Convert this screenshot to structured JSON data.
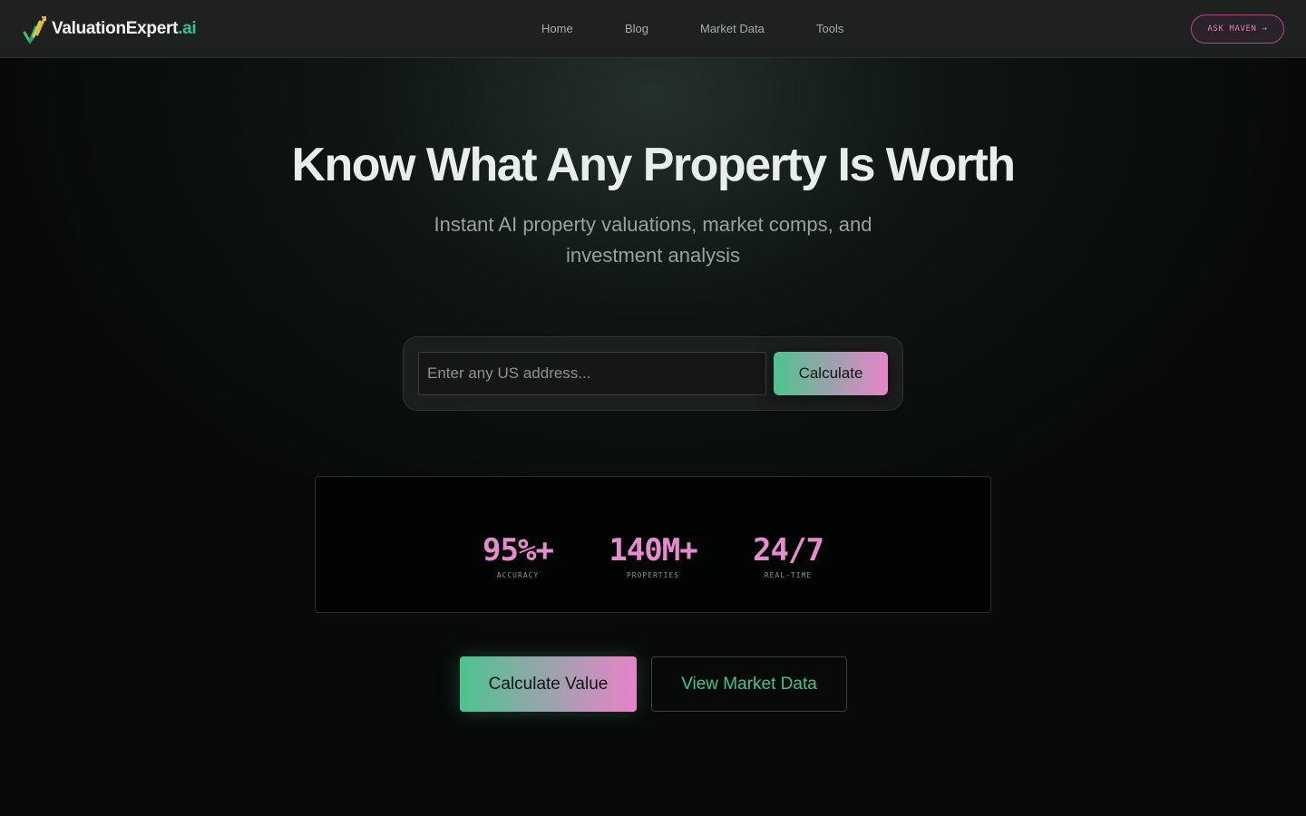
{
  "header": {
    "logo": {
      "main": "ValuationExpert",
      "suffix": ".ai"
    },
    "nav": [
      {
        "label": "Home"
      },
      {
        "label": "Blog"
      },
      {
        "label": "Market Data"
      },
      {
        "label": "Tools"
      }
    ],
    "ask_button": "ASK MAVEN →"
  },
  "hero": {
    "title": "Know What Any Property Is Worth",
    "subtitle": "Instant AI property valuations, market comps, and investment analysis"
  },
  "search": {
    "placeholder": "Enter any US address...",
    "value": "",
    "button_label": "Calculate"
  },
  "stats": [
    {
      "value": "95%+",
      "label": "ACCURACY"
    },
    {
      "value": "140M+",
      "label": "PROPERTIES"
    },
    {
      "value": "24/7",
      "label": "REAL-TIME"
    }
  ],
  "cta": {
    "primary": "Calculate Value",
    "secondary": "View Market Data"
  },
  "colors": {
    "accent_green": "#3cc08a",
    "accent_pink": "#e784c9",
    "background": "#070a09"
  }
}
